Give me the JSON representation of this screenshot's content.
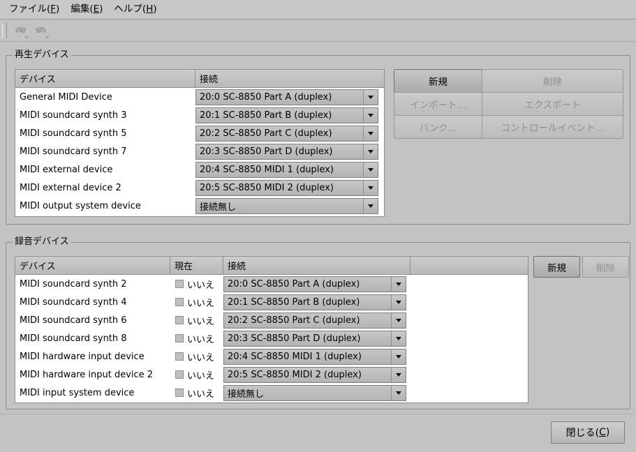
{
  "menubar": {
    "items": [
      {
        "label": "ファイル",
        "accel": "F"
      },
      {
        "label": "編集",
        "accel": "E"
      },
      {
        "label": "ヘルプ",
        "accel": "H"
      }
    ]
  },
  "toolbar": {
    "buttons": [
      {
        "name": "undo",
        "icon": "undo-arrow-icon",
        "enabled": false
      },
      {
        "name": "redo",
        "icon": "redo-arrow-icon",
        "enabled": false
      }
    ]
  },
  "playback": {
    "group_title": "再生デバイス",
    "columns": [
      "デバイス",
      "接続"
    ],
    "rows": [
      {
        "device": "General MIDI Device",
        "connection": "20:0 SC-8850 Part A (duplex)"
      },
      {
        "device": "MIDI soundcard synth 3",
        "connection": "20:1 SC-8850 Part B (duplex)"
      },
      {
        "device": "MIDI soundcard synth 5",
        "connection": "20:2 SC-8850 Part C (duplex)"
      },
      {
        "device": "MIDI soundcard synth 7",
        "connection": "20:3 SC-8850 Part D (duplex)"
      },
      {
        "device": "MIDI external device",
        "connection": "20:4 SC-8850 MIDI 1 (duplex)"
      },
      {
        "device": "MIDI external device 2",
        "connection": "20:5 SC-8850 MIDI 2 (duplex)"
      },
      {
        "device": "MIDI output system device",
        "connection": "接続無し"
      }
    ],
    "buttons": [
      {
        "label": "新規",
        "enabled": true,
        "focused": true
      },
      {
        "label": "削除",
        "enabled": false,
        "focused": false
      },
      {
        "label": "インポート...",
        "enabled": false,
        "focused": false
      },
      {
        "label": "エクスポート",
        "enabled": false,
        "focused": false
      },
      {
        "label": "バンク...",
        "enabled": false,
        "focused": false
      },
      {
        "label": "コントロールイベント...",
        "enabled": false,
        "focused": false
      }
    ]
  },
  "record": {
    "group_title": "録音デバイス",
    "columns": [
      "デバイス",
      "現在",
      "接続",
      ""
    ],
    "rows": [
      {
        "device": "MIDI soundcard synth 2",
        "current_label": "いいえ",
        "current_checked": false,
        "connection": "20:0 SC-8850 Part A (duplex)"
      },
      {
        "device": "MIDI soundcard synth 4",
        "current_label": "いいえ",
        "current_checked": false,
        "connection": "20:1 SC-8850 Part B (duplex)"
      },
      {
        "device": "MIDI soundcard synth 6",
        "current_label": "いいえ",
        "current_checked": false,
        "connection": "20:2 SC-8850 Part C (duplex)"
      },
      {
        "device": "MIDI soundcard synth 8",
        "current_label": "いいえ",
        "current_checked": false,
        "connection": "20:3 SC-8850 Part D (duplex)"
      },
      {
        "device": "MIDI hardware input device",
        "current_label": "いいえ",
        "current_checked": false,
        "connection": "20:4 SC-8850 MIDI 1 (duplex)"
      },
      {
        "device": "MIDI hardware input device 2",
        "current_label": "いいえ",
        "current_checked": false,
        "connection": "20:5 SC-8850 MIDI 2 (duplex)"
      },
      {
        "device": "MIDI input system device",
        "current_label": "いいえ",
        "current_checked": false,
        "connection": "接続無し"
      }
    ],
    "buttons": [
      {
        "label": "新規",
        "enabled": true,
        "focused": true
      },
      {
        "label": "削除",
        "enabled": false,
        "focused": false
      }
    ]
  },
  "footer": {
    "close_label": "閉じる",
    "close_accel": "C"
  },
  "colors": {
    "window_bg": "#c3c3c3",
    "list_bg": "#ffffff",
    "header_bg": "#c0c0c0",
    "border": "#8d8d8d",
    "disabled_text": "#8f8f8f"
  }
}
